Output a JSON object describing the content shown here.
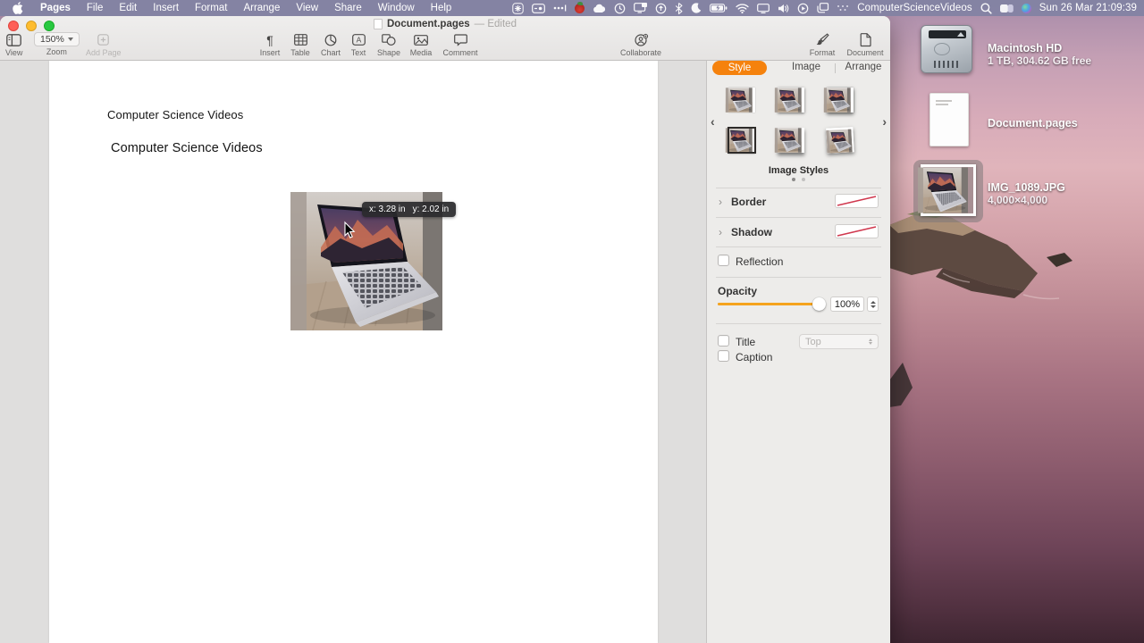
{
  "menubar": {
    "apple_icon": "apple-logo",
    "menus": [
      "Pages",
      "File",
      "Edit",
      "Insert",
      "Format",
      "Arrange",
      "View",
      "Share",
      "Window",
      "Help"
    ],
    "status": {
      "user_name": "ComputerScienceVideos",
      "clock": "Sun 26 Mar 21:09:39",
      "icon_names": [
        "pinwheel-icon",
        "screen-record-icon",
        "more-dots-icon",
        "tomato-app-icon",
        "cloud-icon",
        "time-machine-icon",
        "display-notification-icon",
        "circle-up-icon",
        "bluetooth-icon",
        "do-not-disturb-moon-icon",
        "battery-charging-icon",
        "wifi-icon",
        "display-icon",
        "volume-icon",
        "play-circle-icon",
        "window-stack-icon",
        "input-dots-icon",
        "spotlight-search-icon",
        "user-switcher-icon",
        "siri-icon"
      ]
    }
  },
  "window": {
    "title": "Document.pages",
    "edited": "— Edited",
    "toolbar": {
      "view": "View",
      "zoom_value": "150%",
      "zoom": "Zoom",
      "add_page": "Add Page",
      "insert": "Insert",
      "table": "Table",
      "chart": "Chart",
      "text": "Text",
      "shape": "Shape",
      "media": "Media",
      "comment": "Comment",
      "collaborate": "Collaborate",
      "format": "Format",
      "document": "Document"
    }
  },
  "document": {
    "heading1": "Computer Science Videos",
    "heading2": "Computer Science Videos",
    "tooltip_x": "x: 3.28 in",
    "tooltip_y": "y: 2.02 in"
  },
  "panel": {
    "tabs": [
      "Style",
      "Image",
      "Arrange"
    ],
    "active_tab": "Style",
    "image_styles_label": "Image Styles",
    "pagination": {
      "total_pages": 2,
      "current_page": 1
    },
    "border_label": "Border",
    "shadow_label": "Shadow",
    "reflection_label": "Reflection",
    "opacity_label": "Opacity",
    "opacity_value": "100%",
    "title_label": "Title",
    "title_position": "Top",
    "caption_label": "Caption"
  },
  "desktop": {
    "icons": [
      {
        "label": "Macintosh HD",
        "sub": "1 TB, 304.62 GB free"
      },
      {
        "label": "Document.pages",
        "sub": ""
      },
      {
        "label": "IMG_1089.JPG",
        "sub": "4,000×4,000"
      }
    ]
  },
  "colors": {
    "accent_orange": "#F5820D",
    "slider_orange": "#F5A31D",
    "none_swatch_line": "#D0384E",
    "menubar_tint": "#8483A3"
  }
}
